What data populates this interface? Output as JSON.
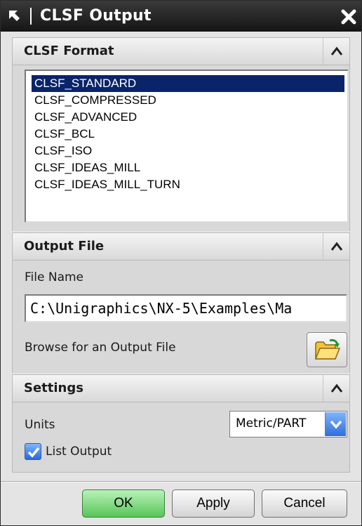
{
  "window": {
    "title": "CLSF Output"
  },
  "sections": {
    "format": {
      "title": "CLSF Format",
      "items": [
        "CLSF_STANDARD",
        "CLSF_COMPRESSED",
        "CLSF_ADVANCED",
        "CLSF_BCL",
        "CLSF_ISO",
        "CLSF_IDEAS_MILL",
        "CLSF_IDEAS_MILL_TURN"
      ],
      "selected": "CLSF_STANDARD"
    },
    "output": {
      "title": "Output File",
      "file_name_label": "File Name",
      "file_name_value": "C:\\Unigraphics\\NX-5\\Examples\\Ma",
      "browse_label": "Browse for an Output File"
    },
    "settings": {
      "title": "Settings",
      "units_label": "Units",
      "units_value": "Metric/PART",
      "list_output_label": "List Output",
      "list_output_checked": true
    }
  },
  "buttons": {
    "ok": "OK",
    "apply": "Apply",
    "cancel": "Cancel"
  },
  "colors": {
    "selection": "#0a246a",
    "ok_button": "#58c558",
    "accent_blue": "#2e6fd8"
  }
}
